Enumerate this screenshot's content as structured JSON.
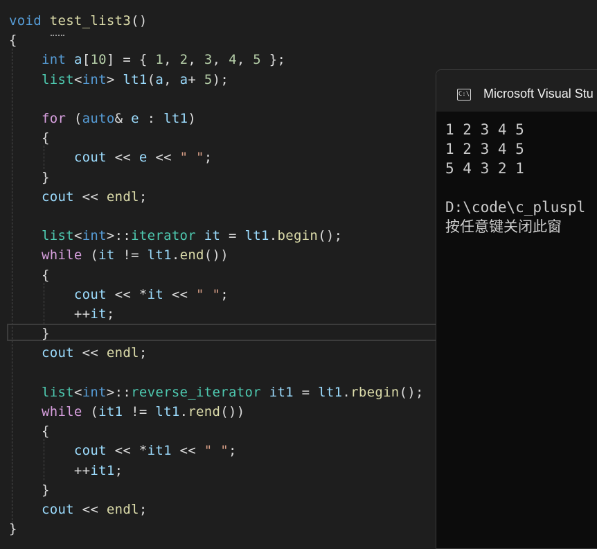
{
  "colors": {
    "background": "#1e1e1e",
    "keyword": "#569cd6",
    "control": "#d8a0df",
    "type_template": "#4ec9b0",
    "function": "#dcdcaa",
    "variable": "#9cdcfe",
    "number": "#b5cea8",
    "string": "#d69d85",
    "plain": "#dcdcdc"
  },
  "editor": {
    "lines": [
      [
        [
          "void",
          "k"
        ],
        [
          " ",
          "p"
        ],
        [
          "test_list3",
          "f"
        ],
        [
          "()",
          "p"
        ]
      ],
      [
        [
          "{",
          "p"
        ]
      ],
      [
        [
          "    ",
          "p"
        ],
        [
          "int",
          "k"
        ],
        [
          " ",
          "p"
        ],
        [
          "a",
          "v"
        ],
        [
          "[",
          "p"
        ],
        [
          "10",
          "n"
        ],
        [
          "] = { ",
          "p"
        ],
        [
          "1",
          "n"
        ],
        [
          ", ",
          "p"
        ],
        [
          "2",
          "n"
        ],
        [
          ", ",
          "p"
        ],
        [
          "3",
          "n"
        ],
        [
          ", ",
          "p"
        ],
        [
          "4",
          "n"
        ],
        [
          ", ",
          "p"
        ],
        [
          "5",
          "n"
        ],
        [
          " };",
          "p"
        ]
      ],
      [
        [
          "    ",
          "p"
        ],
        [
          "list",
          "t"
        ],
        [
          "<",
          "p"
        ],
        [
          "int",
          "k"
        ],
        [
          "> ",
          "p"
        ],
        [
          "lt1",
          "v"
        ],
        [
          "(",
          "p"
        ],
        [
          "a",
          "v"
        ],
        [
          ", ",
          "p"
        ],
        [
          "a",
          "v"
        ],
        [
          "+ ",
          "p"
        ],
        [
          "5",
          "n"
        ],
        [
          ");",
          "p"
        ]
      ],
      [
        [
          "",
          "p"
        ]
      ],
      [
        [
          "    ",
          "p"
        ],
        [
          "for",
          "c"
        ],
        [
          " (",
          "p"
        ],
        [
          "auto",
          "k"
        ],
        [
          "& ",
          "p"
        ],
        [
          "e",
          "v"
        ],
        [
          " : ",
          "p"
        ],
        [
          "lt1",
          "v"
        ],
        [
          ")",
          "p"
        ]
      ],
      [
        [
          "    {",
          "p"
        ]
      ],
      [
        [
          "        ",
          "p"
        ],
        [
          "cout",
          "v"
        ],
        [
          " << ",
          "p"
        ],
        [
          "e",
          "v"
        ],
        [
          " << ",
          "p"
        ],
        [
          "\" \"",
          "s"
        ],
        [
          ";",
          "p"
        ]
      ],
      [
        [
          "    }",
          "p"
        ]
      ],
      [
        [
          "    ",
          "p"
        ],
        [
          "cout",
          "v"
        ],
        [
          " << ",
          "p"
        ],
        [
          "endl",
          "f"
        ],
        [
          ";",
          "p"
        ]
      ],
      [
        [
          "",
          "p"
        ]
      ],
      [
        [
          "    ",
          "p"
        ],
        [
          "list",
          "t"
        ],
        [
          "<",
          "p"
        ],
        [
          "int",
          "k"
        ],
        [
          ">::",
          "p"
        ],
        [
          "iterator",
          "t"
        ],
        [
          " ",
          "p"
        ],
        [
          "it",
          "v"
        ],
        [
          " = ",
          "p"
        ],
        [
          "lt1",
          "v"
        ],
        [
          ".",
          "p"
        ],
        [
          "begin",
          "f"
        ],
        [
          "();",
          "p"
        ]
      ],
      [
        [
          "    ",
          "p"
        ],
        [
          "while",
          "c"
        ],
        [
          " (",
          "p"
        ],
        [
          "it",
          "v"
        ],
        [
          " != ",
          "p"
        ],
        [
          "lt1",
          "v"
        ],
        [
          ".",
          "p"
        ],
        [
          "end",
          "f"
        ],
        [
          "())",
          "p"
        ]
      ],
      [
        [
          "    {",
          "p"
        ]
      ],
      [
        [
          "        ",
          "p"
        ],
        [
          "cout",
          "v"
        ],
        [
          " << *",
          "p"
        ],
        [
          "it",
          "v"
        ],
        [
          " << ",
          "p"
        ],
        [
          "\" \"",
          "s"
        ],
        [
          ";",
          "p"
        ]
      ],
      [
        [
          "        ++",
          "p"
        ],
        [
          "it",
          "v"
        ],
        [
          ";",
          "p"
        ]
      ],
      [
        [
          "    }",
          "p"
        ]
      ],
      [
        [
          "    ",
          "p"
        ],
        [
          "cout",
          "v"
        ],
        [
          " << ",
          "p"
        ],
        [
          "endl",
          "f"
        ],
        [
          ";",
          "p"
        ]
      ],
      [
        [
          "",
          "p"
        ]
      ],
      [
        [
          "    ",
          "p"
        ],
        [
          "list",
          "t"
        ],
        [
          "<",
          "p"
        ],
        [
          "int",
          "k"
        ],
        [
          ">::",
          "p"
        ],
        [
          "reverse_iterator",
          "t"
        ],
        [
          " ",
          "p"
        ],
        [
          "it1",
          "v"
        ],
        [
          " = ",
          "p"
        ],
        [
          "lt1",
          "v"
        ],
        [
          ".",
          "p"
        ],
        [
          "rbegin",
          "f"
        ],
        [
          "();",
          "p"
        ]
      ],
      [
        [
          "    ",
          "p"
        ],
        [
          "while",
          "c"
        ],
        [
          " (",
          "p"
        ],
        [
          "it1",
          "v"
        ],
        [
          " != ",
          "p"
        ],
        [
          "lt1",
          "v"
        ],
        [
          ".",
          "p"
        ],
        [
          "rend",
          "f"
        ],
        [
          "())",
          "p"
        ]
      ],
      [
        [
          "    {",
          "p"
        ]
      ],
      [
        [
          "        ",
          "p"
        ],
        [
          "cout",
          "v"
        ],
        [
          " << *",
          "p"
        ],
        [
          "it1",
          "v"
        ],
        [
          " << ",
          "p"
        ],
        [
          "\" \"",
          "s"
        ],
        [
          ";",
          "p"
        ]
      ],
      [
        [
          "        ++",
          "p"
        ],
        [
          "it1",
          "v"
        ],
        [
          ";",
          "p"
        ]
      ],
      [
        [
          "    }",
          "p"
        ]
      ],
      [
        [
          "    ",
          "p"
        ],
        [
          "cout",
          "v"
        ],
        [
          " << ",
          "p"
        ],
        [
          "endl",
          "f"
        ],
        [
          ";",
          "p"
        ]
      ],
      [
        [
          "}",
          "p"
        ]
      ]
    ]
  },
  "console": {
    "title": "Microsoft Visual Stu",
    "icon": "terminal-icon",
    "icon_text": "C:\\",
    "output": [
      "1 2 3 4 5",
      "1 2 3 4 5",
      "5 4 3 2 1",
      "",
      "D:\\code\\c_pluspl",
      "按任意键关闭此窗"
    ]
  }
}
